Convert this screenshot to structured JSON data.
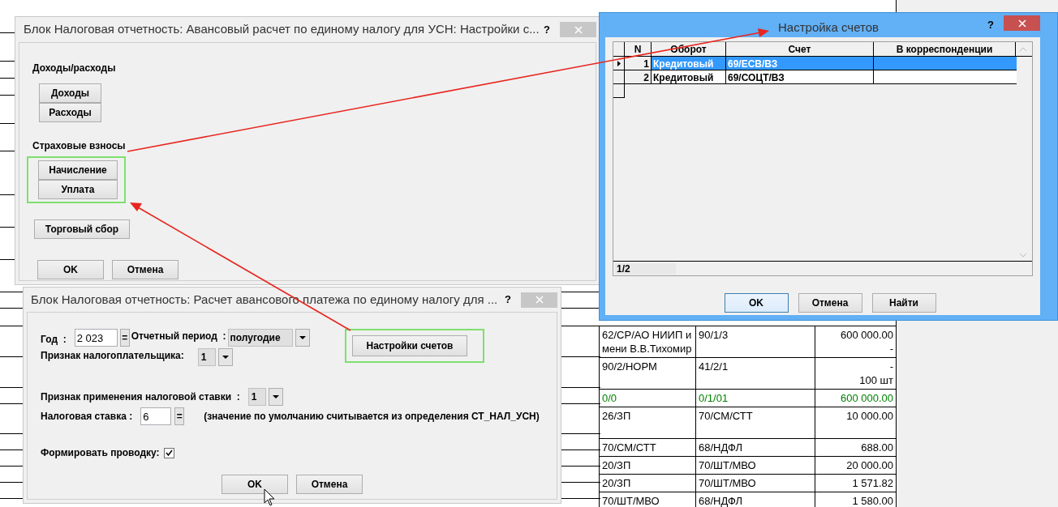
{
  "background_table": {
    "rows": [
      {
        "color": "#000000",
        "cells": [
          [
            "62/СР/АО НИИП и",
            "мени В.В.Тихомир"
          ],
          [
            "90/1/3"
          ],
          [
            "600 000.00",
            "-"
          ]
        ]
      },
      {
        "color": "#000000",
        "cells": [
          [
            "90/2/НОРМ"
          ],
          [
            "41/2/1"
          ],
          [
            "-",
            "100 шт"
          ]
        ]
      },
      {
        "color": "#008000",
        "cells": [
          [
            "0/0"
          ],
          [
            "0/1/01"
          ],
          [
            "600 000.00"
          ]
        ]
      },
      {
        "color": "#000000",
        "cells": [
          [
            "26/ЗП"
          ],
          [
            "70/СМ/СТТ"
          ],
          [
            "10 000.00"
          ]
        ]
      },
      {
        "color": "#000000",
        "cells": [
          [
            "70/СМ/СТТ"
          ],
          [
            "68/НДФЛ"
          ],
          [
            "688.00"
          ]
        ]
      },
      {
        "color": "#000000",
        "cells": [
          [
            "20/ЗП"
          ],
          [
            "70/ШТ/МВО"
          ],
          [
            "20 000.00"
          ]
        ]
      },
      {
        "color": "#000000",
        "cells": [
          [
            "20/ЗП"
          ],
          [
            "70/ШТ/МВО"
          ],
          [
            "1 571.82"
          ]
        ]
      },
      {
        "color": "#000000",
        "cells": [
          [
            "70/ШТ/МВО"
          ],
          [
            "68/НДФЛ"
          ],
          [
            "1 580.00"
          ]
        ]
      }
    ]
  },
  "settings_dialog": {
    "title": "Блок Налоговая отчетность: Авансовый расчет по единому налогу для УСН: Настройки с...",
    "help": "?",
    "groups": [
      {
        "label": "Доходы/расходы",
        "highlighted": false,
        "buttons": [
          "Доходы",
          "Расходы"
        ]
      },
      {
        "label": "Страховые взносы",
        "highlighted": true,
        "buttons": [
          "Начисление",
          "Уплата"
        ]
      }
    ],
    "extra_button": "Торговый сбор",
    "buttons": [
      "OK",
      "Отмена"
    ]
  },
  "accounts_dialog": {
    "title": "Настройка счетов",
    "help": "?",
    "columns": [
      "N",
      "Оборот",
      "Счет",
      "В корреспонденции"
    ],
    "rows": [
      {
        "n": "1",
        "turnover": "Кредитовый",
        "account": "69/ЕСВ/ВЗ",
        "selected": true
      },
      {
        "n": "2",
        "turnover": "Кредитовый",
        "account": "69/СОЦТ/ВЗ",
        "selected": false
      }
    ],
    "record_counter": "1/2",
    "buttons": [
      {
        "label": "OK",
        "focused": true
      },
      {
        "label": "Отмена",
        "focused": false
      },
      {
        "label": "Найти",
        "focused": false
      }
    ]
  },
  "calc_dialog": {
    "title": "Блок Налоговая отчетность: Расчет авансового платежа по единому налогу для ...",
    "help": "?",
    "year": {
      "label": "Год  :",
      "value": "2 023",
      "button": "="
    },
    "period": {
      "label": "Отчетный период  :",
      "value": "полугодие"
    },
    "taxpayer_sign": {
      "label": "Признак налогоплательщика:",
      "value": "1"
    },
    "rate_sign": {
      "label": "Признак применения налоговой ставки  :",
      "value": "1"
    },
    "rate": {
      "label": "Налоговая ставка :",
      "value": "6",
      "button": "=",
      "note": "(значение по умолчанию считывается из определения СТ_НАЛ_УСН)"
    },
    "post_entry": {
      "label": "Формировать проводку:",
      "checked": true
    },
    "accounts_button": {
      "label": "Настройки счетов",
      "highlighted": true
    },
    "buttons": [
      "OK",
      "Отмена"
    ]
  }
}
